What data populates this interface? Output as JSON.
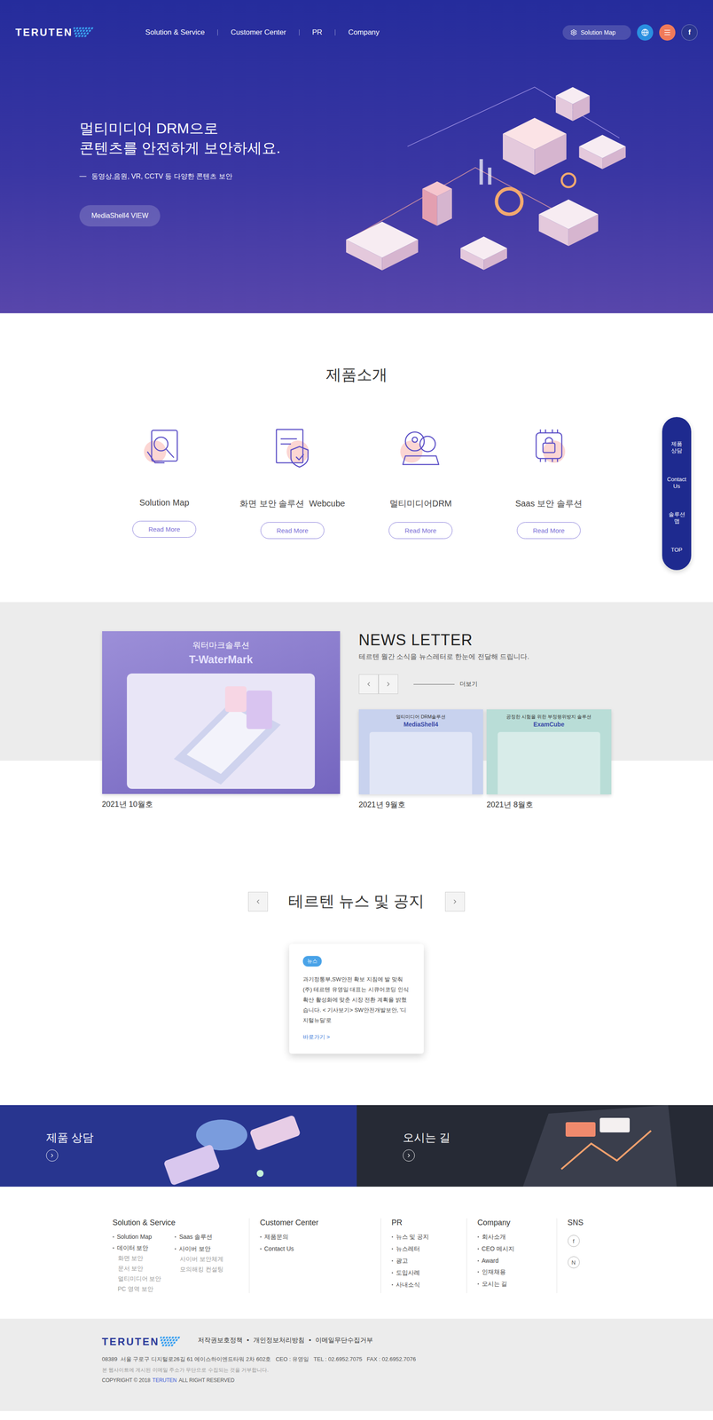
{
  "header": {
    "logo": "TERUTEN",
    "nav": [
      "Solution & Service",
      "Customer Center",
      "PR",
      "Company"
    ],
    "solution_map": "Solution Map",
    "facebook": "f"
  },
  "hero": {
    "title_lines": [
      "멀티미디어 DRM으로",
      "콘텐츠를 안전하게 보안하세요."
    ],
    "dash": "—",
    "subtitle": "동영상,음원, VR, CCTV 등 다양한 콘텐츠 보안",
    "button": "MediaShell4 VIEW"
  },
  "products": {
    "title": "제품소개",
    "items": [
      {
        "name": "Solution Map",
        "button": "Read More"
      },
      {
        "name": "화면 보안 솔루션  Webcube",
        "button": "Read More"
      },
      {
        "name": "멀티미디어DRM",
        "button": "Read More"
      },
      {
        "name": "Saas 보안 솔루션",
        "button": "Read More"
      }
    ]
  },
  "quick_menu": [
    "제품 상담",
    "Contact Us",
    "솔루션 맵",
    "TOP"
  ],
  "newsletter": {
    "feature": {
      "label": "워터마크솔루션",
      "product": "T-WaterMark",
      "date": "2021년 10월호"
    },
    "title": "NEWS LETTER",
    "subtitle": "테르텐 월간 소식을 뉴스레터로 한눈에 전달해 드립니다.",
    "more": "더보기",
    "cards": [
      {
        "label": "멀티미디어 DRM솔루션",
        "product": "MediaShell4",
        "date": "2021년 9월호",
        "color": "#c8d2ee"
      },
      {
        "label": "공정한 시험을 위한 부정행위방지 솔루션",
        "product": "ExamCube",
        "date": "2021년 8월호",
        "color": "#b9ddd7"
      }
    ]
  },
  "news": {
    "title": "테르텐 뉴스 및 공지",
    "post": {
      "badge": "뉴스",
      "text": "과기정통부,SW안전 확보 지침에 발 맞춰(주) 테르텐 유영일 대표는 시큐어코딩 인식 확산 활성화에 맞춘 시장 전환 계획을 밝혔습니다. < 기사보기> SW안전개발보안, '디지털뉴딜'로",
      "link": "바로가기 >"
    }
  },
  "banners": [
    {
      "label": "제품 상담"
    },
    {
      "label": "오시는 길"
    }
  ],
  "footer_nav": [
    {
      "title": "Solution & Service",
      "lists": [
        [
          {
            "label": "Solution Map",
            "kind": "main"
          },
          {
            "label": "데이터 보안",
            "kind": "main"
          },
          {
            "label": "화면 보안",
            "kind": "sub"
          },
          {
            "label": "문서 보안",
            "kind": "sub"
          },
          {
            "label": "멀티미디어 보안",
            "kind": "sub"
          },
          {
            "label": "PC 영역 보안",
            "kind": "sub"
          }
        ],
        [
          {
            "label": "Saas 솔루션",
            "kind": "main"
          },
          {
            "label": "사이버 보안",
            "kind": "main"
          },
          {
            "label": "사이버 보안체계",
            "kind": "sub"
          },
          {
            "label": "모의해킹 컨설팅",
            "kind": "sub"
          }
        ]
      ]
    },
    {
      "title": "Customer Center",
      "lists": [
        [
          {
            "label": "제품문의",
            "kind": "main"
          },
          {
            "label": "Contact Us",
            "kind": "main"
          }
        ]
      ]
    },
    {
      "title": "PR",
      "lists": [
        [
          {
            "label": "뉴스 및 공지",
            "kind": "main"
          },
          {
            "label": "뉴스레터",
            "kind": "main"
          },
          {
            "label": "광고",
            "kind": "main"
          },
          {
            "label": "도입사례",
            "kind": "main"
          },
          {
            "label": "사내소식",
            "kind": "main"
          }
        ]
      ]
    },
    {
      "title": "Company",
      "lists": [
        [
          {
            "label": "회사소개",
            "kind": "main"
          },
          {
            "label": "CEO 메시지",
            "kind": "main"
          },
          {
            "label": "Award",
            "kind": "main"
          },
          {
            "label": "인재채용",
            "kind": "main"
          },
          {
            "label": "오시는 길",
            "kind": "main"
          }
        ]
      ]
    }
  ],
  "sns": {
    "title": "SNS",
    "items": [
      "f",
      "N"
    ]
  },
  "footer": {
    "logo": "TERUTEN",
    "links": [
      "저작권보호정책",
      "개인정보처리방침",
      "이메일무단수집거부"
    ],
    "link_separator": "•",
    "address": "08389  서울 구로구 디지털로26길 61 에이스하이엔드타워 2차 602호   CEO : 유영일   TEL : 02.6952.7075   FAX : 02.6952.7076",
    "notice": "본 웹사이트에 게시된 이메일 주소가 무단으로 수집되는 것을 거부합니다.",
    "copyright_before": "COPYRIGHT © 2018",
    "copyright_brand": "TERUTEN",
    "copyright_after": "ALL RIGHT RESERVED"
  }
}
